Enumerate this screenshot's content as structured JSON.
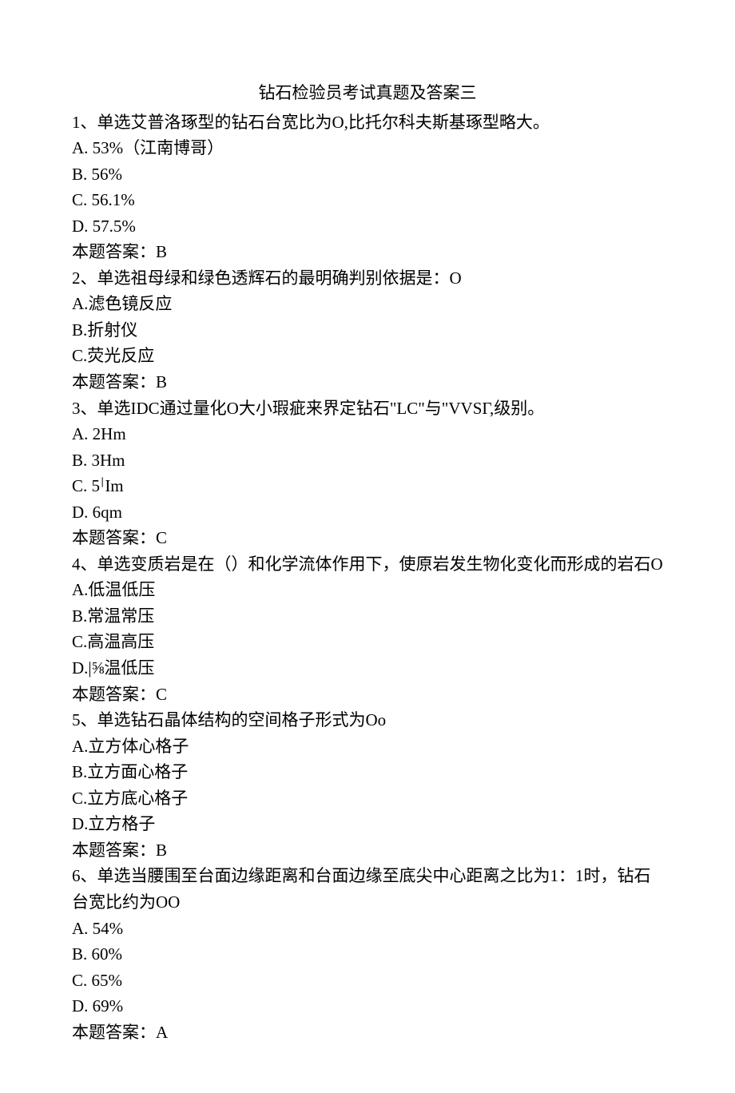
{
  "title": "钻石检验员考试真题及答案三",
  "questions": [
    {
      "stem": "1、单选艾普洛琢型的钻石台宽比为O,比托尔科夫斯基琢型略大。",
      "options": [
        "A. 53%（江南博哥）",
        "B. 56%",
        "C. 56.1%",
        "D. 57.5%"
      ],
      "answer": "本题答案：B"
    },
    {
      "stem": "2、单选祖母绿和绿色透辉石的最明确判别依据是：O",
      "options": [
        "A.滤色镜反应",
        "B.折射仪",
        "C.荧光反应"
      ],
      "answer": "本题答案：B"
    },
    {
      "stem": "3、单选IDC通过量化O大小瑕疵来界定钻石\"LC\"与\"VVSΓ,级别。",
      "options": [
        "A. 2Hm",
        "B. 3Hm",
        "C. 5∣Im",
        "D. 6qm"
      ],
      "answer": "本题答案：C"
    },
    {
      "stem": "4、单选变质岩是在（）和化学流体作用下，使原岩发生物化变化而形成的岩石O",
      "options": [
        "A.低温低压",
        "B.常温常压",
        "C.高温高压",
        "D.|⅝温低压"
      ],
      "answer": "本题答案：C"
    },
    {
      "stem": "5、单选钻石晶体结构的空间格子形式为Oo",
      "options": [
        "A.立方体心格子",
        "B.立方面心格子",
        "C.立方底心格子",
        "D.立方格子"
      ],
      "answer": "本题答案：B"
    },
    {
      "stem": "6、单选当腰围至台面边缘距离和台面边缘至底尖中心距离之比为1：1时，钻石台宽比约为OO",
      "options": [
        "A. 54%",
        "B. 60%",
        "C. 65%",
        "D. 69%"
      ],
      "answer": "本题答案：A"
    }
  ]
}
